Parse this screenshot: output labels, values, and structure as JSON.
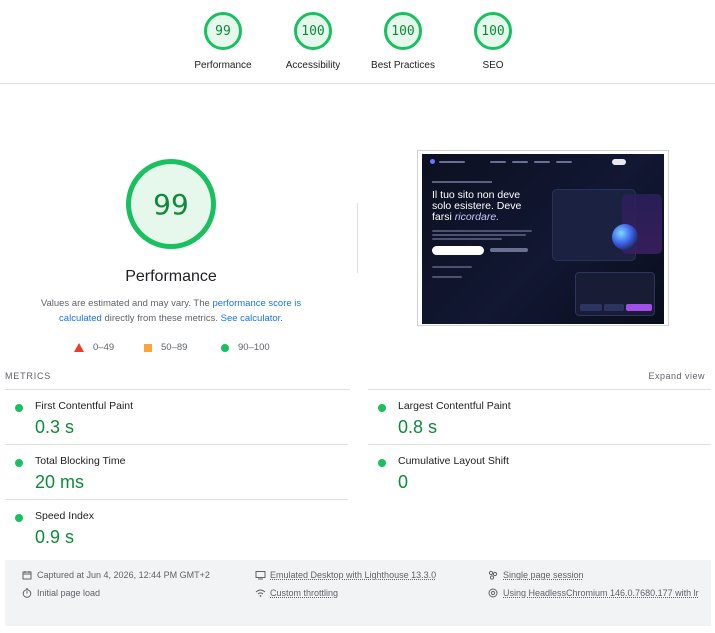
{
  "categories": [
    {
      "score": "99",
      "label": "Performance"
    },
    {
      "score": "100",
      "label": "Accessibility"
    },
    {
      "score": "100",
      "label": "Best Practices"
    },
    {
      "score": "100",
      "label": "SEO"
    }
  ],
  "performance": {
    "score": "99",
    "title": "Performance",
    "desc_1": "Values are estimated and may vary. The ",
    "desc_link_1": "performance score is calculated",
    "desc_2": " directly from these metrics. ",
    "desc_link_2": "See calculator",
    "desc_3": "."
  },
  "legend": {
    "fail": "0–49",
    "average": "50–89",
    "pass": "90–100",
    "colors": {
      "fail": "#eb3b2b",
      "average": "#ffa33b",
      "pass": "#19c060"
    }
  },
  "thumbnail": {
    "headline_1": "Il tuo sito non deve solo esistere.",
    "headline_2": "Deve farsi ",
    "headline_em": "ricordare."
  },
  "metrics": {
    "heading": "METRICS",
    "expand": "Expand view",
    "items": [
      {
        "name": "First Contentful Paint",
        "value": "0.3 s"
      },
      {
        "name": "Largest Contentful Paint",
        "value": "0.8 s"
      },
      {
        "name": "Total Blocking Time",
        "value": "20 ms"
      },
      {
        "name": "Cumulative Layout Shift",
        "value": "0"
      },
      {
        "name": "Speed Index",
        "value": "0.9 s"
      }
    ]
  },
  "run_info": {
    "captured": "Captured at Jun 4, 2026, 12:44 PM GMT+2",
    "initial_load": "Initial page load",
    "emulated": "Emulated Desktop with Lighthouse 13.3.0",
    "throttling": "Custom throttling",
    "session": "Single page session",
    "browser": "Using HeadlessChromium 146.0.7680.177 with lr"
  },
  "icons": {
    "calendar": "calendar-icon",
    "timer": "timer-icon",
    "desktop": "desktop-icon",
    "wifi": "wifi-icon",
    "session": "people-icon",
    "browser": "chrome-icon"
  }
}
